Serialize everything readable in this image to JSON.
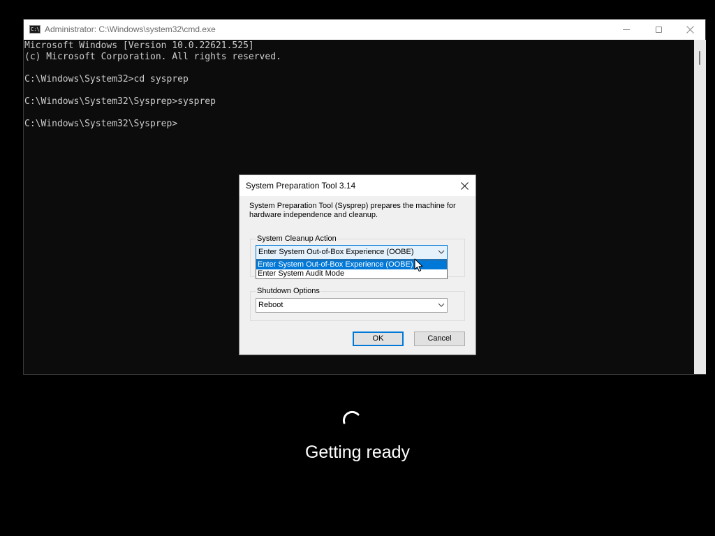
{
  "cmd_window": {
    "icon_text": "C:\\",
    "title": "Administrator: C:\\Windows\\system32\\cmd.exe",
    "console_lines": [
      "Microsoft Windows [Version 10.0.22621.525]",
      "(c) Microsoft Corporation. All rights reserved.",
      "",
      "C:\\Windows\\System32>cd sysprep",
      "",
      "C:\\Windows\\System32\\Sysprep>sysprep",
      "",
      "C:\\Windows\\System32\\Sysprep>"
    ]
  },
  "sysprep_dialog": {
    "title": "System Preparation Tool 3.14",
    "description": "System Preparation Tool (Sysprep) prepares the machine for hardware independence and cleanup.",
    "cleanup_action": {
      "label": "System Cleanup Action",
      "selected": "Enter System Out-of-Box Experience (OOBE)",
      "options": [
        "Enter System Out-of-Box Experience (OOBE)",
        "Enter System Audit Mode"
      ]
    },
    "shutdown_options": {
      "label": "Shutdown Options",
      "selected": "Reboot"
    },
    "ok_label": "OK",
    "cancel_label": "Cancel"
  },
  "overlay": {
    "status_text": "Getting ready"
  },
  "colors": {
    "accent": "#0078d7",
    "console_text": "#cccccc",
    "console_background": "#0c0c0c"
  },
  "icons": {
    "cmd_app": "cmd-app-icon",
    "minimize": "minimize-icon",
    "maximize": "maximize-icon",
    "close": "close-icon",
    "dropdown": "chevron-down-icon",
    "pointer": "mouse-pointer-icon",
    "spinner": "loading-spinner-icon"
  }
}
